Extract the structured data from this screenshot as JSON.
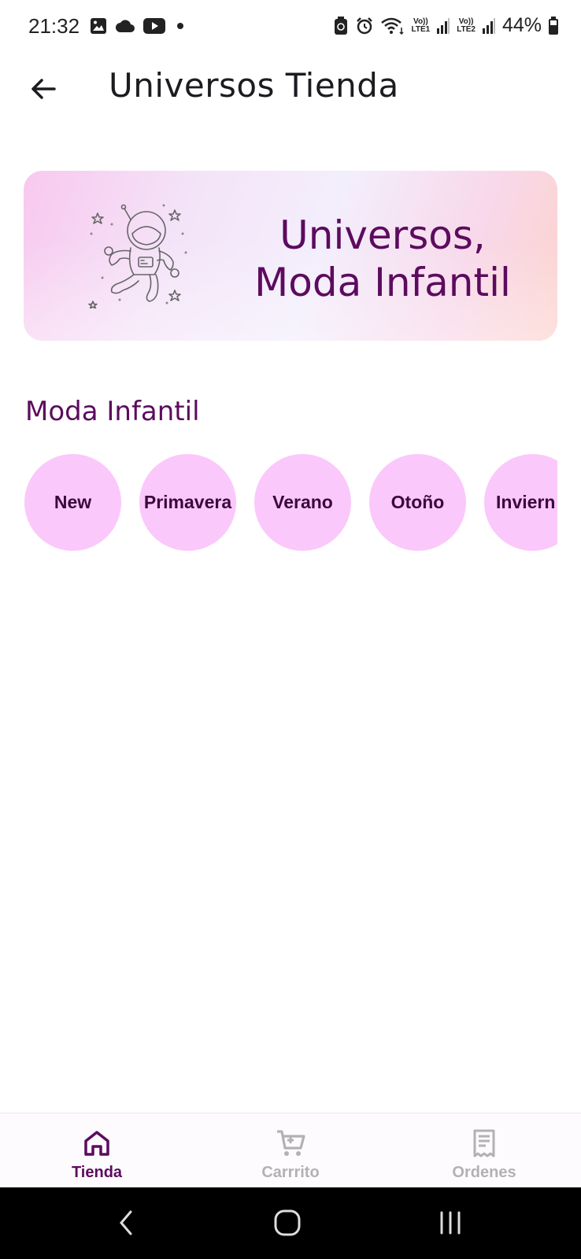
{
  "status_bar": {
    "time": "21:32",
    "battery": "44%",
    "sim1": "LTE1",
    "sim2": "LTE2",
    "volte1": "Vo))",
    "volte2": "Vo))",
    "icons": [
      "image-icon",
      "cloud-icon",
      "youtube-icon",
      "dot-icon",
      "battery-saver-icon",
      "alarm-icon",
      "wifi-icon",
      "signal-icon",
      "battery-icon"
    ]
  },
  "app_bar": {
    "title": "Universos Tienda",
    "back_icon": "arrow-left-icon"
  },
  "banner": {
    "line1": "Universos,",
    "line2": "Moda Infantil",
    "illustration": "astronaut-illustration"
  },
  "section": {
    "title": "Moda Infantil",
    "categories": [
      {
        "label": "New"
      },
      {
        "label": "Primavera"
      },
      {
        "label": "Verano"
      },
      {
        "label": "Otoño"
      },
      {
        "label": "Inviern"
      }
    ]
  },
  "bottom_nav": {
    "items": [
      {
        "label": "Tienda",
        "icon": "home-icon",
        "active": true
      },
      {
        "label": "Carrrito",
        "icon": "cart-icon",
        "active": false
      },
      {
        "label": "Ordenes",
        "icon": "receipt-icon",
        "active": false
      }
    ]
  },
  "colors": {
    "accent": "#5c0b5e",
    "chip_bg": "#fbc8fb",
    "inactive": "#b5b0b6"
  }
}
